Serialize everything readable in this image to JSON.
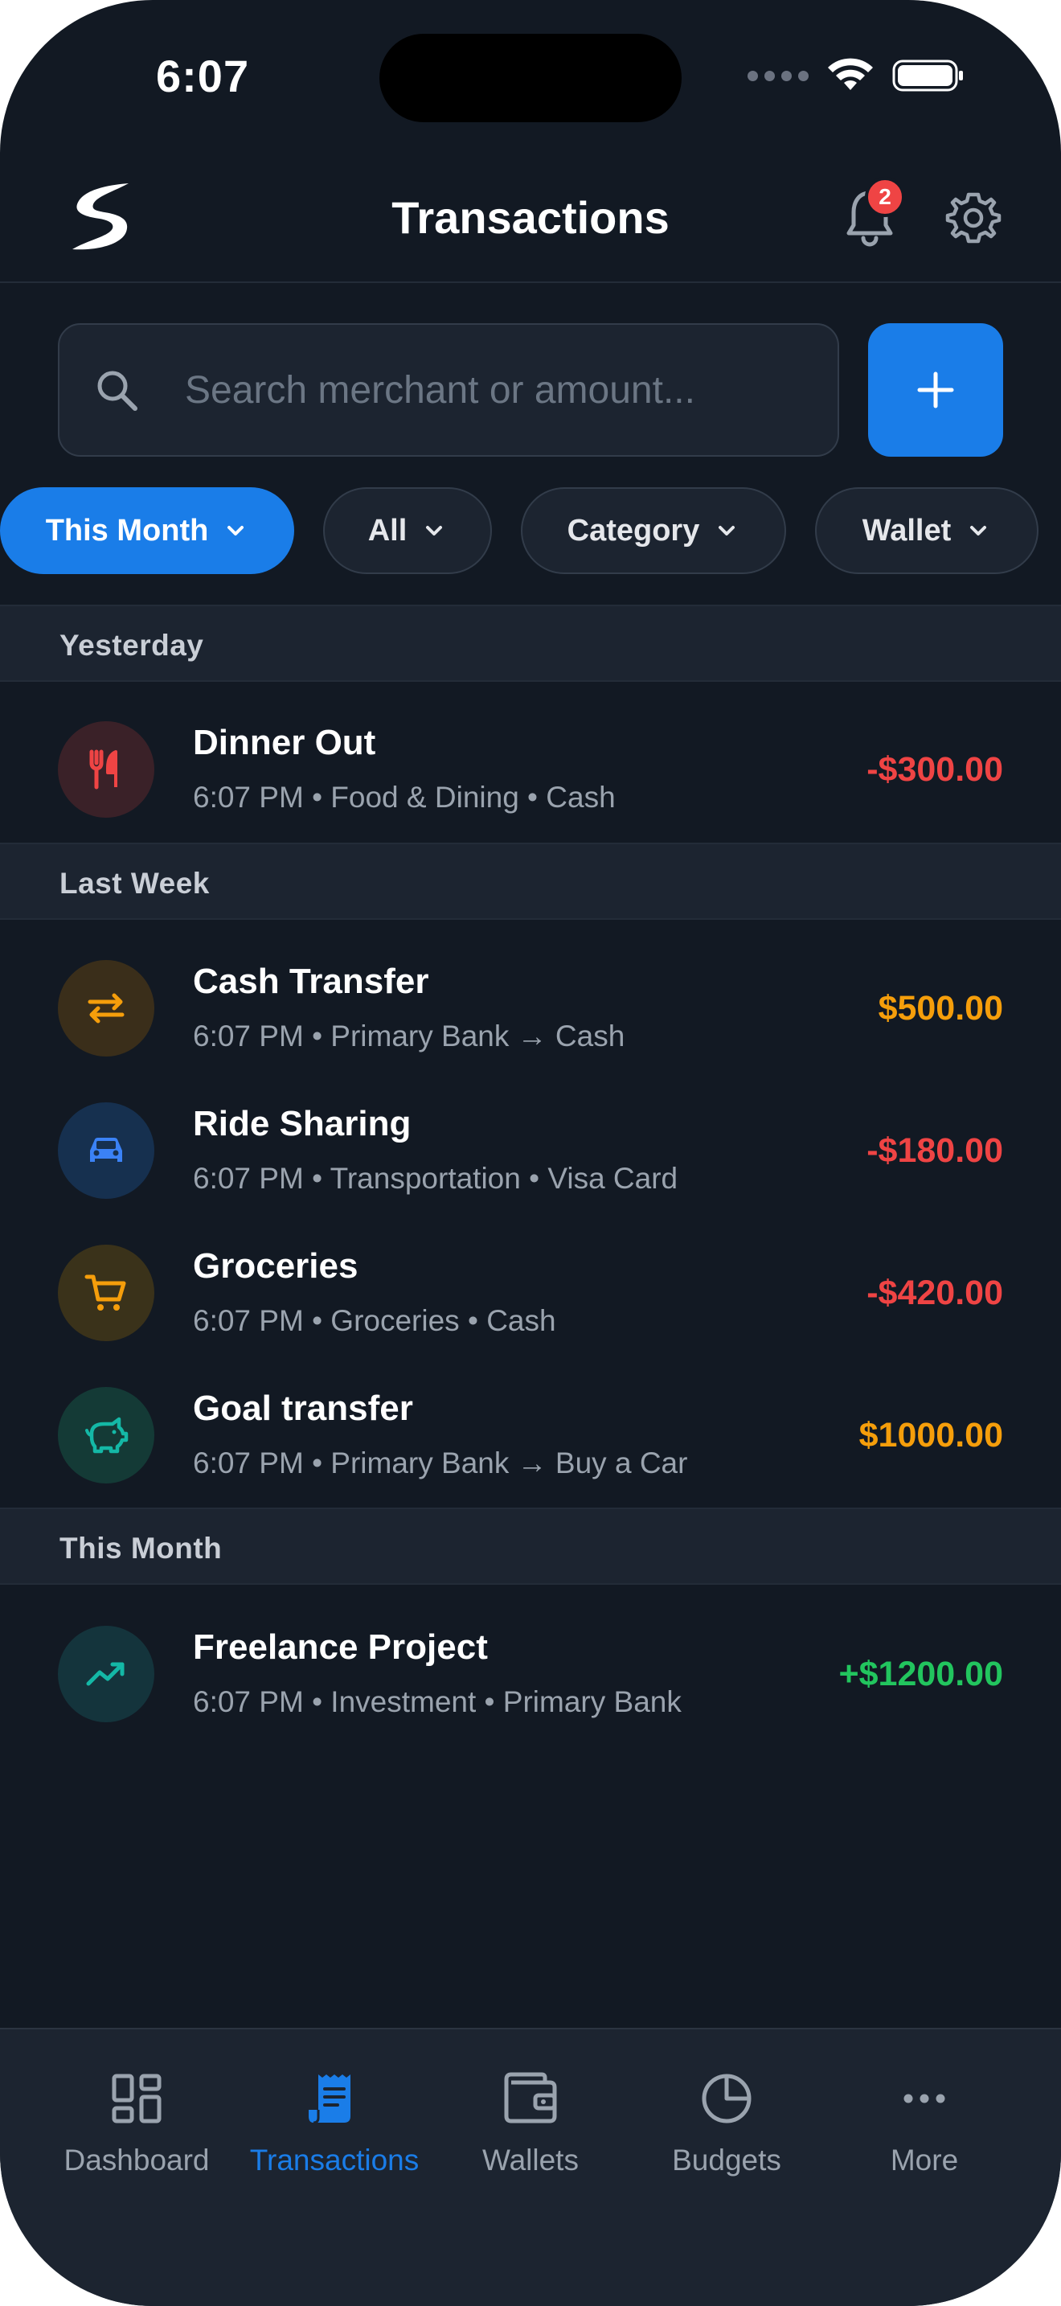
{
  "status_bar": {
    "time": "6:07"
  },
  "header": {
    "title": "Transactions",
    "notification_count": "2",
    "logo_icon": "s-logo-icon",
    "bell_icon": "bell-icon",
    "settings_icon": "gear-icon"
  },
  "search": {
    "placeholder": "Search merchant or amount...",
    "value": ""
  },
  "filters": [
    {
      "label": "This Month",
      "active": true
    },
    {
      "label": "All",
      "active": false
    },
    {
      "label": "Category",
      "active": false
    },
    {
      "label": "Wallet",
      "active": false
    }
  ],
  "sections": [
    {
      "title": "Yesterday",
      "transactions": [
        {
          "name": "Dinner Out",
          "meta": "6:07 PM • Food & Dining • Cash",
          "amount": "-$300.00",
          "icon": "fork-knife-icon",
          "color": "#ef4444",
          "bg": "#3a2128"
        }
      ]
    },
    {
      "title": "Last Week",
      "transactions": [
        {
          "name": "Cash Transfer",
          "meta": "6:07 PM • Primary Bank → Cash",
          "amount": "$500.00",
          "icon": "transfer-arrows-icon",
          "color": "#f59e0b",
          "bg": "#3a2e1a"
        },
        {
          "name": "Ride Sharing",
          "meta": "6:07 PM • Transportation • Visa Card",
          "amount": "-$180.00",
          "icon": "car-icon",
          "color": "#ef4444",
          "bg": "#16304f"
        },
        {
          "name": "Groceries",
          "meta": "6:07 PM • Groceries • Cash",
          "amount": "-$420.00",
          "icon": "shopping-cart-icon",
          "color": "#ef4444",
          "bg": "#3a321a"
        },
        {
          "name": "Goal transfer",
          "meta": "6:07 PM • Primary Bank → Buy a Car",
          "amount": "$1000.00",
          "icon": "piggy-bank-icon",
          "color": "#f59e0b",
          "bg": "#143a36"
        }
      ]
    },
    {
      "title": "This Month",
      "transactions": [
        {
          "name": "Freelance Project",
          "meta": "6:07 PM • Investment • Primary Bank",
          "amount": "+$1200.00",
          "icon": "trending-up-icon",
          "color": "#22c55e",
          "bg": "#14343c"
        }
      ]
    }
  ],
  "bottom_nav": [
    {
      "label": "Dashboard",
      "icon": "dashboard-icon",
      "active": false
    },
    {
      "label": "Transactions",
      "icon": "receipt-icon",
      "active": true
    },
    {
      "label": "Wallets",
      "icon": "wallet-icon",
      "active": false
    },
    {
      "label": "Budgets",
      "icon": "pie-chart-icon",
      "active": false
    },
    {
      "label": "More",
      "icon": "more-dots-icon",
      "active": false
    }
  ],
  "colors": {
    "accent": "#1a7de8",
    "expense": "#ef4444",
    "transfer": "#f59e0b",
    "income": "#22c55e",
    "background": "#121923"
  }
}
